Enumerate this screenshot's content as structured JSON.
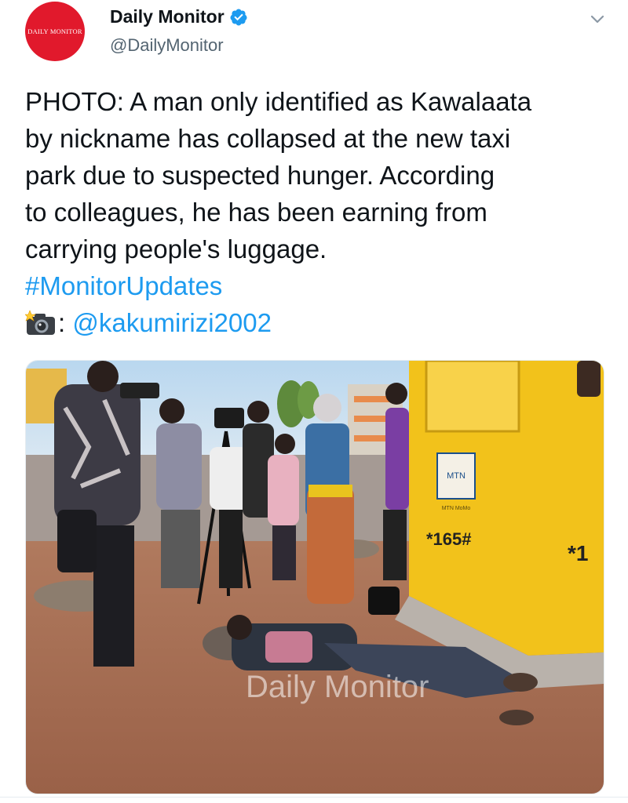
{
  "author": {
    "display_name": "Daily Monitor",
    "handle": "@DailyMonitor",
    "avatar_text": "DAILY MONITOR",
    "verified_icon": "verified-badge-icon",
    "brand_color": "#e1192c"
  },
  "tweet": {
    "lines": [
      "PHOTO: A man only identified as Kawalaata",
      "by nickname has collapsed at the new taxi",
      "park due to suspected hunger. According",
      "to colleagues, he has been earning from",
      "carrying people's luggage."
    ],
    "hashtag": "#MonitorUpdates",
    "credit_separator": ":",
    "credit_mention": "@kakumirizi2002",
    "credit_icon": "camera-flash-icon"
  },
  "photo": {
    "watermark": "Daily Monitor",
    "kiosk_code": "*165#",
    "kiosk_code_partial": "*1",
    "kiosk_brand": "MTN",
    "kiosk_small_text": "MTN MoMo"
  },
  "colors": {
    "link": "#1d9bf0",
    "text": "#0f1419",
    "secondary": "#536471",
    "kiosk_yellow": "#f2c21b"
  }
}
